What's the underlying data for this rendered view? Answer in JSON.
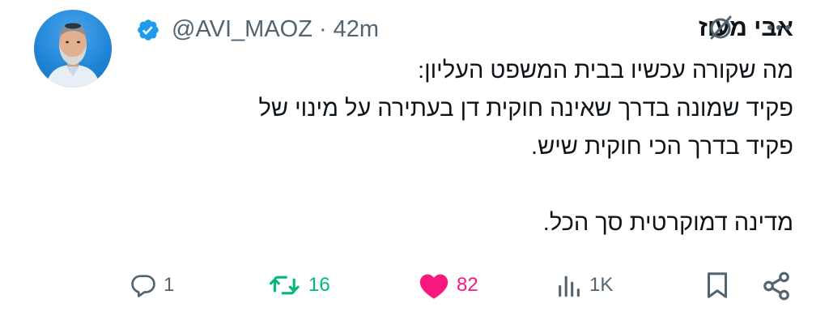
{
  "author": {
    "display_name": "אבי מעוז",
    "handle": "@AVI_MAOZ",
    "separator": "·",
    "timestamp": "42m",
    "verified_icon": "verified-badge-icon"
  },
  "tweet": {
    "lines": [
      "מה שקורה עכשיו בבית המשפט העליון:",
      "פקיד שמונה בדרך שאינה חוקית דן בעתירה על מינוי של",
      "פקיד בדרך הכי חוקית שיש."
    ],
    "closing": "מדינה דמוקרטית סך הכל."
  },
  "actions": {
    "replies": "1",
    "retweets": "16",
    "likes": "82",
    "views": "1K"
  },
  "colors": {
    "text": "#0f1419",
    "secondary": "#536471",
    "verified": "#1d9bf0",
    "retweet": "#00ba7c",
    "like": "#f91880"
  }
}
